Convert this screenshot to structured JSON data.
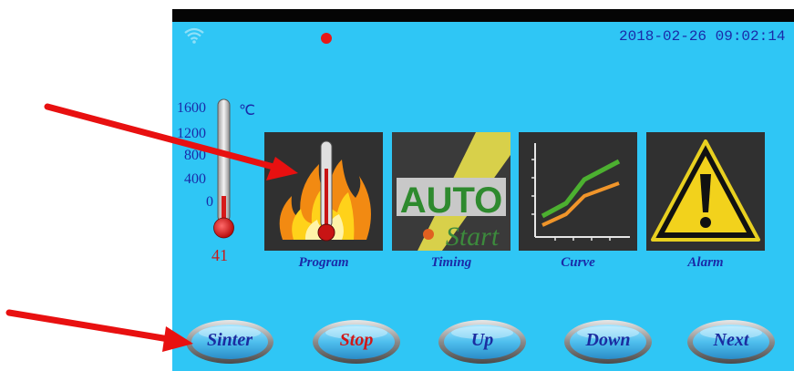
{
  "status": {
    "datetime": "2018-02-26 09:02:14",
    "recording_color": "#e81818"
  },
  "thermometer": {
    "unit": "℃",
    "scale": [
      "1600",
      "1200",
      "800",
      "400",
      "0"
    ],
    "current_value": "41"
  },
  "tiles": [
    {
      "label": "Program",
      "icon": "fire-thermometer-icon"
    },
    {
      "label": "Timing",
      "icon": "auto-start-icon",
      "badge_text": "AUTO",
      "sub_text": "Start"
    },
    {
      "label": "Curve",
      "icon": "curve-chart-icon"
    },
    {
      "label": "Alarm",
      "icon": "warning-triangle-icon"
    }
  ],
  "buttons": [
    {
      "label": "Sinter",
      "color": "#1b2ca0"
    },
    {
      "label": "Stop",
      "color": "#d01818"
    },
    {
      "label": "Up",
      "color": "#1b2ca0"
    },
    {
      "label": "Down",
      "color": "#1b2ca0"
    },
    {
      "label": "Next",
      "color": "#1b2ca0"
    }
  ],
  "colors": {
    "screen_bg": "#2fc6f5",
    "text_blue": "#1a2aa8",
    "annotation_arrow": "#e81010"
  }
}
